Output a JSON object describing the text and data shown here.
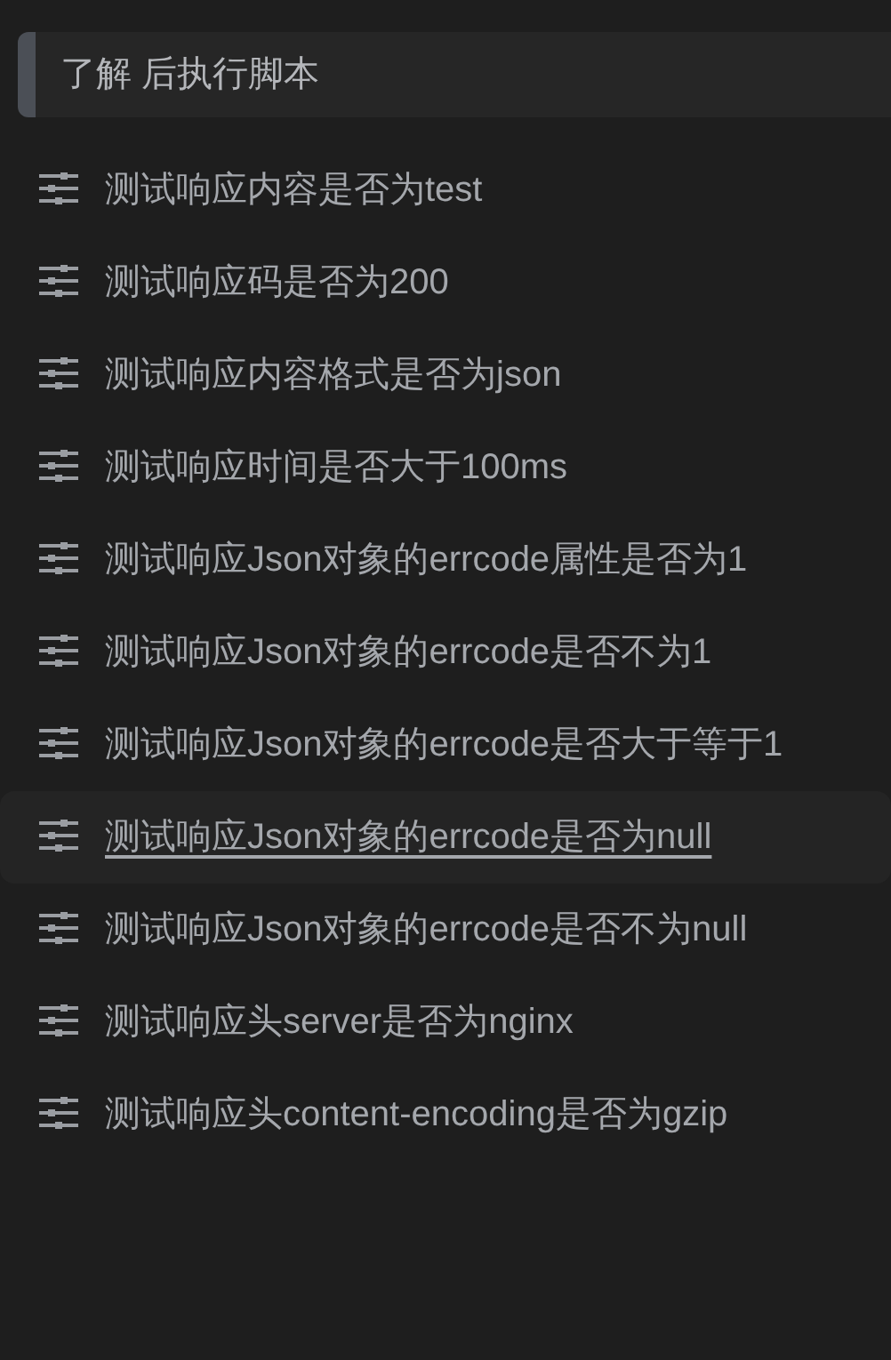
{
  "header": {
    "title": "了解 后执行脚本"
  },
  "scripts": [
    {
      "label": "测试响应内容是否为test",
      "hovered": false
    },
    {
      "label": "测试响应码是否为200",
      "hovered": false
    },
    {
      "label": "测试响应内容格式是否为json",
      "hovered": false
    },
    {
      "label": "测试响应时间是否大于100ms",
      "hovered": false
    },
    {
      "label": "测试响应Json对象的errcode属性是否为1",
      "hovered": false
    },
    {
      "label": "测试响应Json对象的errcode是否不为1",
      "hovered": false
    },
    {
      "label": "测试响应Json对象的errcode是否大于等于1",
      "hovered": false
    },
    {
      "label": "测试响应Json对象的errcode是否为null",
      "hovered": true
    },
    {
      "label": "测试响应Json对象的errcode是否不为null",
      "hovered": false
    },
    {
      "label": "测试响应头server是否为nginx",
      "hovered": false
    },
    {
      "label": "测试响应头content-encoding是否为gzip",
      "hovered": false
    }
  ]
}
